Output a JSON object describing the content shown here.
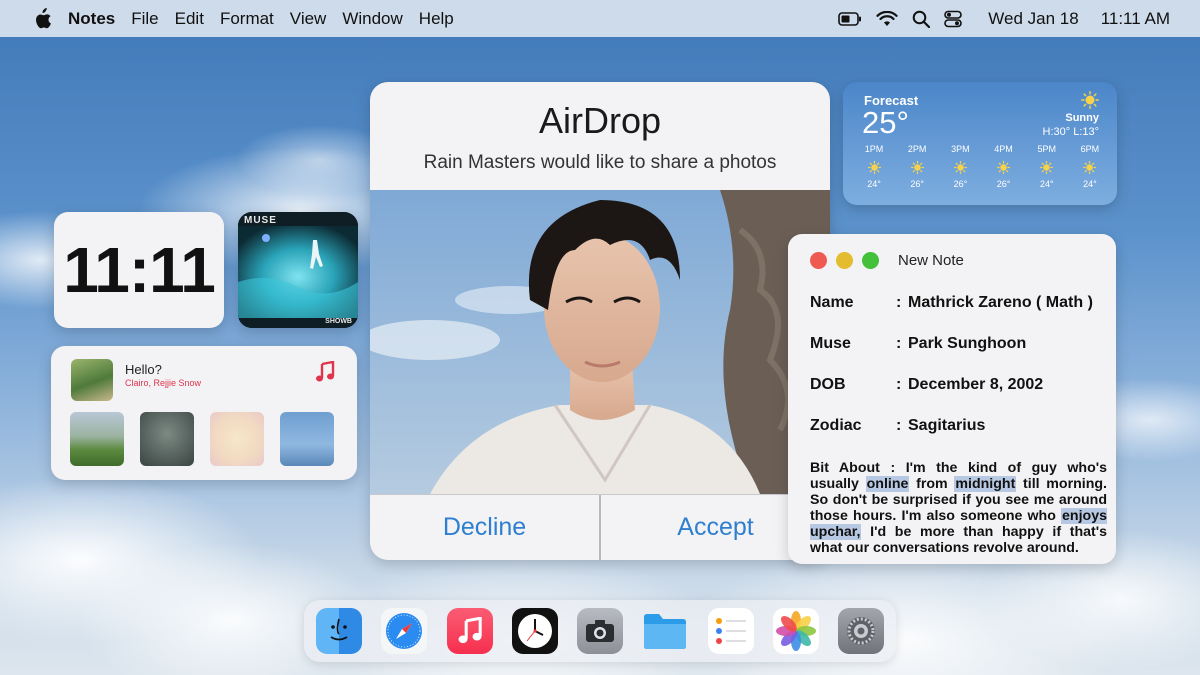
{
  "menubar": {
    "app_name": "Notes",
    "menus": [
      "File",
      "Edit",
      "Format",
      "View",
      "Window",
      "Help"
    ],
    "date": "Wed Jan 18",
    "time": "11:11 AM",
    "icons": [
      "apple-icon",
      "battery-icon",
      "wifi-icon",
      "search-icon",
      "control-center-icon"
    ]
  },
  "clock_widget": {
    "time": "11:11"
  },
  "album_widget": {
    "artist_text": "MUSE",
    "title_text": "SHOWB"
  },
  "music_widget": {
    "song": "Hello?",
    "artist": "Clairo, Rejjie Snow",
    "icon": "music-note-icon",
    "accent": "#e0344c"
  },
  "airdrop": {
    "title": "AirDrop",
    "message": "Rain Masters would like to share a photos",
    "decline_label": "Decline",
    "accept_label": "Accept",
    "button_color": "#2f7fd0"
  },
  "forecast": {
    "title": "Forecast",
    "temperature": "25°",
    "condition": "Sunny",
    "high_low": "H:30° L:13°",
    "hours": [
      {
        "time": "1PM",
        "temp": "24°"
      },
      {
        "time": "2PM",
        "temp": "26°"
      },
      {
        "time": "3PM",
        "temp": "26°"
      },
      {
        "time": "4PM",
        "temp": "26°"
      },
      {
        "time": "5PM",
        "temp": "24°"
      },
      {
        "time": "6PM",
        "temp": "24°"
      }
    ]
  },
  "note": {
    "window_title": "New Note",
    "fields": [
      {
        "key": "Name",
        "value": "Mathrick Zareno ( Math )"
      },
      {
        "key": "Muse",
        "value": "Park Sunghoon"
      },
      {
        "key": "DOB",
        "value": "December 8, 2002"
      },
      {
        "key": "Zodiac",
        "value": "Sagitarius"
      }
    ],
    "bio_key": "Bit About",
    "bio_parts": [
      ": I'm the  kind of guy who's usually ",
      "online",
      " from ",
      "midnight",
      " till morning. So don't be surprised if you see me around those hours. I'm also someone  who ",
      "enjoys upchar,",
      "  I'd be more than happy if that's what our conversations revolve around."
    ],
    "highlight_color": "#b7c8e3"
  },
  "dock": {
    "apps": [
      "Finder",
      "Safari",
      "Music",
      "Clock",
      "Camera",
      "Files",
      "Reminders",
      "Photos",
      "Settings"
    ]
  }
}
